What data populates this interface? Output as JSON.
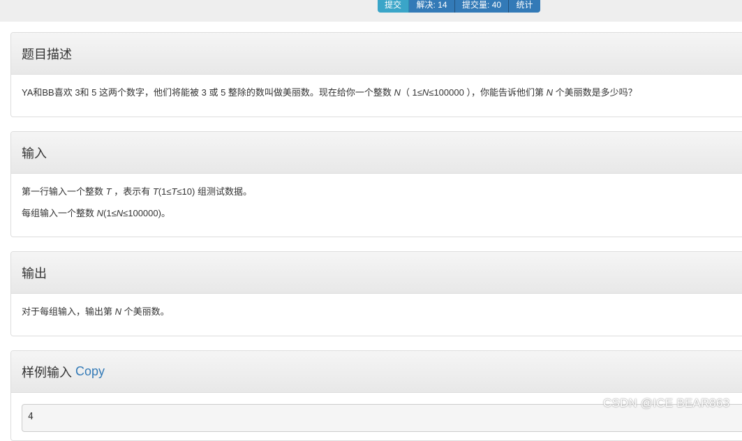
{
  "toolbar": {
    "submit_label": "提交",
    "solved_label": "解决: 14",
    "submissions_label": "提交量: 40",
    "stats_label": "统计"
  },
  "description": {
    "title": "题目描述",
    "text_1": "YA和BB喜欢 3和 5 这两个数字，他们将能被 3 或 5 整除的数叫做美丽数。现在给你一个整数 ",
    "var_n": "N",
    "text_2": "（ 1≤",
    "text_3": "≤100000 ），你能告诉他们第 ",
    "text_4": " 个美丽数是多少吗？"
  },
  "input": {
    "title": "输入",
    "line1_a": "第一行输入一个整数 ",
    "var_t": "T",
    "line1_b": " ，表示有 ",
    "line1_c": "(1≤",
    "line1_d": "≤10) 组测试数据。",
    "line2_a": "每组输入一个整数 ",
    "var_n": "N",
    "line2_b": "(1≤",
    "line2_c": "≤100000)。"
  },
  "output": {
    "title": "输出",
    "text_a": "对于每组输入，输出第 ",
    "var_n": "N",
    "text_b": " 个美丽数。"
  },
  "sample_input": {
    "title": "样例输入",
    "copy_label": "Copy",
    "content": "4"
  },
  "watermark": "CSDN @ICE BEAR863"
}
